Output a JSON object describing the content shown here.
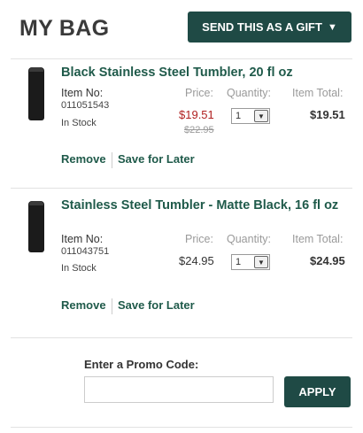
{
  "header": {
    "title": "MY BAG",
    "gift_button_label": "SEND THIS AS A GIFT",
    "gift_caret": "▼"
  },
  "columns": {
    "price": "Price:",
    "quantity": "Quantity:",
    "total": "Item Total:"
  },
  "items": [
    {
      "name": "Black Stainless Steel Tumbler, 20 fl oz",
      "item_no_label": "Item No:",
      "item_no": "011051543",
      "stock": "In Stock",
      "sale_price": "$19.51",
      "original_price": "$22.95",
      "quantity": "1",
      "total": "$19.51",
      "remove": "Remove",
      "save_later": "Save for Later"
    },
    {
      "name": "Stainless Steel Tumbler - Matte Black, 16 fl oz",
      "item_no_label": "Item No:",
      "item_no": "011043751",
      "stock": "In Stock",
      "price": "$24.95",
      "quantity": "1",
      "total": "$24.95",
      "remove": "Remove",
      "save_later": "Save for Later"
    }
  ],
  "promo": {
    "label": "Enter a Promo Code:",
    "value": "",
    "placeholder": "",
    "apply_label": "APPLY"
  },
  "colors": {
    "brand": "#1f4a45",
    "link": "#1f5a4a",
    "sale": "#b02020"
  }
}
